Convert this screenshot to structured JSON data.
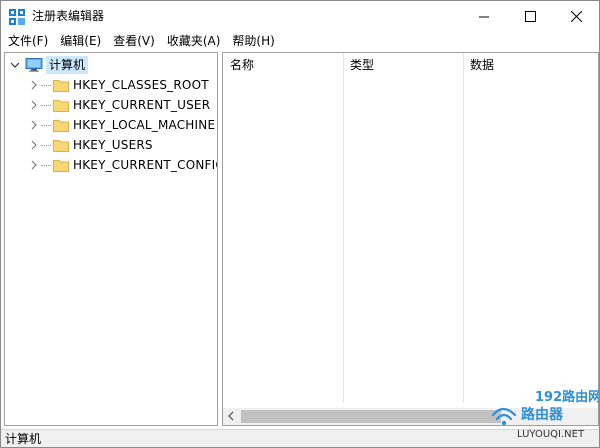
{
  "window": {
    "title": "注册表编辑器",
    "icon": "regedit-icon"
  },
  "menu": [
    {
      "label": "文件(F)"
    },
    {
      "label": "编辑(E)"
    },
    {
      "label": "查看(V)"
    },
    {
      "label": "收藏夹(A)"
    },
    {
      "label": "帮助(H)"
    }
  ],
  "tree": {
    "root": "计算机",
    "hives": [
      {
        "label": "HKEY_CLASSES_ROOT"
      },
      {
        "label": "HKEY_CURRENT_USER"
      },
      {
        "label": "HKEY_LOCAL_MACHINE"
      },
      {
        "label": "HKEY_USERS"
      },
      {
        "label": "HKEY_CURRENT_CONFIG"
      }
    ]
  },
  "list": {
    "columns": [
      "名称",
      "类型",
      "数据"
    ]
  },
  "status": {
    "path": "计算机"
  },
  "watermark": {
    "line1": "192路由网",
    "line2": "路由器",
    "line3": "LUYOUQI.NET"
  },
  "colors": {
    "selection": "#cce8ff",
    "folder": "#f8d775",
    "folder_edge": "#dcb042",
    "scroll_thumb": "#c1c1c1",
    "watermark_blue": "#2f8fd8"
  }
}
